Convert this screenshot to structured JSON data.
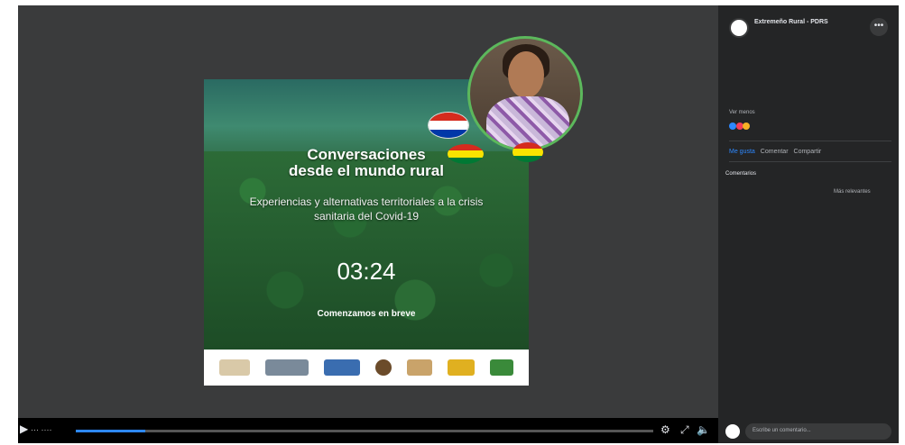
{
  "slide": {
    "title_line1": "Conversaciones",
    "title_line2": "desde el mundo rural",
    "subtitle": "Experiencias y alternativas territoriales a la crisis sanitaria del Covid-19",
    "countdown": "03:24",
    "status": "Comenzamos en breve"
  },
  "controls": {
    "progress_fraction": 0.12,
    "play_icon": "play-icon",
    "settings_icon": "gear-icon",
    "fullscreen_icon": "fullscreen-icon",
    "volume_icon": "volume-icon"
  },
  "post": {
    "page_name": "Extremeño Rural - PDRS",
    "subline": "",
    "date": "",
    "text": "",
    "see_more": "Ver menos",
    "reactions": "",
    "actions": [
      "Me gusta",
      "Comentar",
      "Compartir"
    ],
    "comments_label": "Comentarios",
    "comments_sort": "",
    "view_more": "Más relevantes",
    "composer_placeholder": "Escribe un comentario..."
  },
  "colors": {
    "accent": "#2d88ff",
    "sidebar_bg": "#242526",
    "player_bg": "#3a3b3c",
    "camera_ring": "#5cb85c"
  }
}
